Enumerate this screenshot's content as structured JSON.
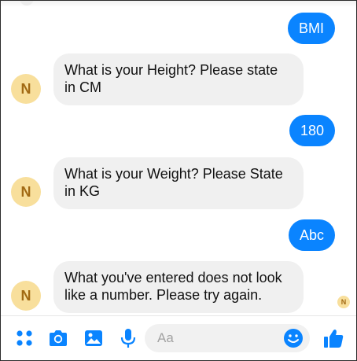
{
  "messages": [
    {
      "side": "out",
      "text": "BMI"
    },
    {
      "side": "in",
      "avatar": "N",
      "text": "What is your Height? Please state in CM"
    },
    {
      "side": "out",
      "text": "180"
    },
    {
      "side": "in",
      "avatar": "N",
      "text": "What is your Weight? Please State in KG"
    },
    {
      "side": "out",
      "text": "Abc"
    },
    {
      "side": "in",
      "avatar": "N",
      "text": "What you've entered does not look like a number. Please try again."
    }
  ],
  "seen_indicator": "N",
  "composer": {
    "placeholder": "Aa",
    "icons": [
      "more-apps-icon",
      "camera-icon",
      "gallery-icon",
      "microphone-icon",
      "emoji-icon",
      "thumbs-up-icon"
    ]
  },
  "colors": {
    "outgoing_bubble": "#0a84ff",
    "incoming_bubble": "#f0f0f0",
    "avatar_bg": "#f8df9c",
    "avatar_text": "#a26a14",
    "icon_blue": "#0a84ff"
  }
}
